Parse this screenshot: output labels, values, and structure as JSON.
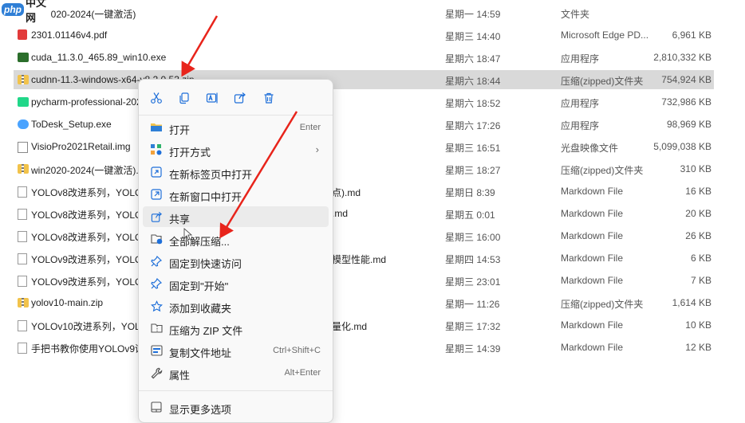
{
  "watermark": {
    "badge": "php",
    "text": "中文网"
  },
  "files": [
    {
      "name": "win2020-2024(一键激活)",
      "name_tail": "",
      "date": "星期一 14:59",
      "type": "文件夹",
      "size": "",
      "icon": "folder-icon"
    },
    {
      "name": "2301.01146v4.pdf",
      "name_tail": "",
      "date": "星期三 14:40",
      "type": "Microsoft Edge PD...",
      "size": "6,961 KB",
      "icon": "pdf-icon"
    },
    {
      "name": "cuda_11.3.0_465.89_win10.exe",
      "name_tail": "",
      "date": "星期六 18:47",
      "type": "应用程序",
      "size": "2,810,332 KB",
      "icon": "nvidia-exe-icon"
    },
    {
      "name": "cudnn-11.3-windows-x64-v8.2.0.53.zip",
      "name_tail": "",
      "date": "星期六 18:44",
      "type": "压缩(zipped)文件夹",
      "size": "754,924 KB",
      "icon": "zip-icon"
    },
    {
      "name": "pycharm-professional-202",
      "name_tail": "",
      "date": "星期六 18:52",
      "type": "应用程序",
      "size": "732,986 KB",
      "icon": "pycharm-icon"
    },
    {
      "name": "ToDesk_Setup.exe",
      "name_tail": "",
      "date": "星期六 17:26",
      "type": "应用程序",
      "size": "98,969 KB",
      "icon": "todesk-icon"
    },
    {
      "name": "VisioPro2021Retail.img",
      "name_tail": "",
      "date": "星期三 16:51",
      "type": "光盘映像文件",
      "size": "5,099,038 KB",
      "icon": "disc-image-icon"
    },
    {
      "name": "win2020-2024(一键激活).z",
      "name_tail": "",
      "date": "星期三 18:27",
      "type": "压缩(zipped)文件夹",
      "size": "310 KB",
      "icon": "zip-icon"
    },
    {
      "name": "YOLOv8改进系列，YOLOv",
      "name_tail": "点).md",
      "date": "星期日 8:39",
      "type": "Markdown File",
      "size": "16 KB",
      "icon": "markdown-file-icon"
    },
    {
      "name": "YOLOv8改进系列，YOLOv",
      "name_tail": ".md",
      "date": "星期五 0:01",
      "type": "Markdown File",
      "size": "20 KB",
      "icon": "markdown-file-icon"
    },
    {
      "name": "YOLOv8改进系列，YOLOv",
      "name_tail": "",
      "date": "星期三 16:00",
      "type": "Markdown File",
      "size": "26 KB",
      "icon": "markdown-file-icon"
    },
    {
      "name": "YOLOv9改进系列，YOLOv",
      "name_tail": "模型性能.md",
      "date": "星期四 14:53",
      "type": "Markdown File",
      "size": "6 KB",
      "icon": "markdown-file-icon"
    },
    {
      "name": "YOLOv9改进系列，YOLOv",
      "name_tail": "",
      "date": "星期三 23:01",
      "type": "Markdown File",
      "size": "7 KB",
      "icon": "markdown-file-icon"
    },
    {
      "name": "yolov10-main.zip",
      "name_tail": "",
      "date": "星期一 11:26",
      "type": "压缩(zipped)文件夹",
      "size": "1,614 KB",
      "icon": "zip-icon"
    },
    {
      "name": "YOLOv10改进系列，YOLOv",
      "name_tail": "量化.md",
      "date": "星期三 17:32",
      "type": "Markdown File",
      "size": "10 KB",
      "icon": "markdown-file-icon"
    },
    {
      "name": "手把书教你使用YOLOv9训练",
      "name_tail": "",
      "date": "星期三 14:39",
      "type": "Markdown File",
      "size": "12 KB",
      "icon": "markdown-file-icon"
    }
  ],
  "menu": {
    "toolbar": [
      "cut-icon",
      "copy-icon",
      "rename-icon",
      "share-icon",
      "delete-icon"
    ],
    "items": [
      {
        "label": "打开",
        "shortcut": "Enter",
        "icon": "folder-open-icon"
      },
      {
        "label": "打开方式",
        "shortcut": "",
        "icon": "open-with-icon",
        "submenu": true
      },
      {
        "label": "在新标签页中打开",
        "shortcut": "",
        "icon": "new-tab-icon"
      },
      {
        "label": "在新窗口中打开",
        "shortcut": "",
        "icon": "new-window-icon"
      },
      {
        "label": "共享",
        "shortcut": "",
        "icon": "share-icon"
      },
      {
        "label": "全部解压缩...",
        "shortcut": "",
        "icon": "extract-icon"
      },
      {
        "label": "固定到快速访问",
        "shortcut": "",
        "icon": "pin-icon"
      },
      {
        "label": "固定到\"开始\"",
        "shortcut": "",
        "icon": "pin-start-icon"
      },
      {
        "label": "添加到收藏夹",
        "shortcut": "",
        "icon": "star-icon"
      },
      {
        "label": "压缩为 ZIP 文件",
        "shortcut": "",
        "icon": "zip-compress-icon"
      },
      {
        "label": "复制文件地址",
        "shortcut": "Ctrl+Shift+C",
        "icon": "copy-path-icon"
      },
      {
        "label": "属性",
        "shortcut": "Alt+Enter",
        "icon": "properties-icon"
      },
      {
        "label": "显示更多选项",
        "shortcut": "",
        "icon": "more-options-icon"
      }
    ]
  },
  "colors": {
    "accent": "#1e6fd9",
    "arrow": "#e8241b",
    "selected_row": "#d9d9d9"
  }
}
